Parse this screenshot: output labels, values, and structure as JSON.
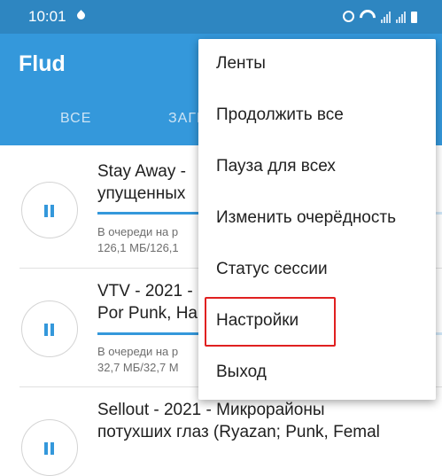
{
  "status_bar": {
    "time": "10:01",
    "icons": [
      "water-drop-icon",
      "alarm-icon",
      "wifi-icon",
      "signal-icon",
      "signal-icon",
      "battery-icon"
    ]
  },
  "app": {
    "title": "Flud",
    "tabs": [
      {
        "label": "ВСЕ"
      },
      {
        "label": "ЗАГР"
      }
    ]
  },
  "torrents": [
    {
      "title": "Stay Away -\nупущенных",
      "status": "В очереди на р",
      "size": "126,1 МБ/126,1",
      "progress": 0.41,
      "icon": "pause-icon"
    },
    {
      "title": "VTV - 2021 -\nPor Punk, Ha",
      "status": "В очереди на р",
      "size": "32,7 МБ/32,7 М",
      "progress": 0.41,
      "icon": "pause-icon"
    },
    {
      "title": "Sellout - 2021 - Микрорайоны\nпотухших глаз (Ryazan; Punk, Femal",
      "icon": "pause-icon"
    }
  ],
  "menu": {
    "items": [
      {
        "label": "Ленты"
      },
      {
        "label": "Продолжить все"
      },
      {
        "label": "Пауза для всех"
      },
      {
        "label": "Изменить очерёдность"
      },
      {
        "label": "Статус сессии"
      },
      {
        "label": "Настройки",
        "highlighted": true
      },
      {
        "label": "Выход"
      }
    ]
  },
  "colors": {
    "status_bar": "#2e86c1",
    "app_bar": "#3498db",
    "accent": "#3498db",
    "highlight_border": "#e02020"
  }
}
